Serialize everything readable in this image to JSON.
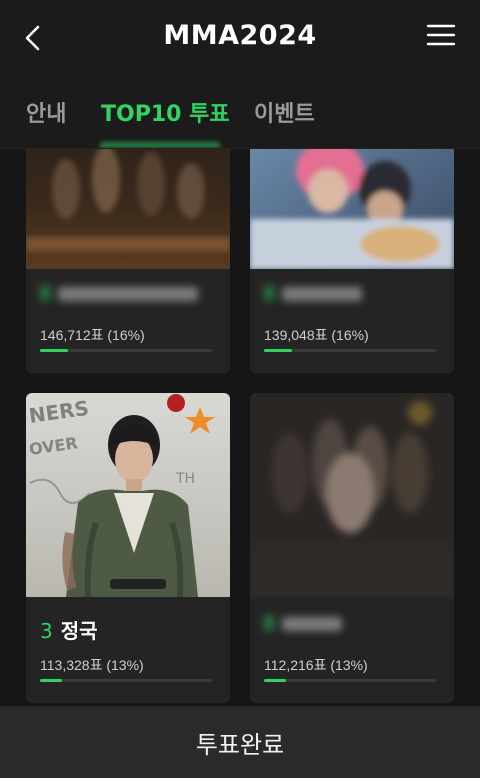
{
  "header": {
    "title": "MMA2024",
    "back_icon": "chevron-left-icon",
    "menu_icon": "hamburger-menu-icon"
  },
  "tabs": [
    {
      "label": "안내",
      "active": false
    },
    {
      "label": "TOP10 투표",
      "active": true
    },
    {
      "label": "이벤트",
      "active": false
    }
  ],
  "accent_color": "#2fd563",
  "cards": [
    {
      "rank": "",
      "name": "",
      "votes": "146,712표 (16%)",
      "percent": 16,
      "name_blurred": true
    },
    {
      "rank": "",
      "name": "",
      "votes": "139,048표 (16%)",
      "percent": 16,
      "name_blurred": true
    },
    {
      "rank": "3",
      "name": "정국",
      "votes": "113,328표 (13%)",
      "percent": 13,
      "name_blurred": false
    },
    {
      "rank": "",
      "name": "",
      "votes": "112,216표 (13%)",
      "percent": 13,
      "name_blurred": true
    }
  ],
  "footer": {
    "button_label": "투표완료"
  }
}
